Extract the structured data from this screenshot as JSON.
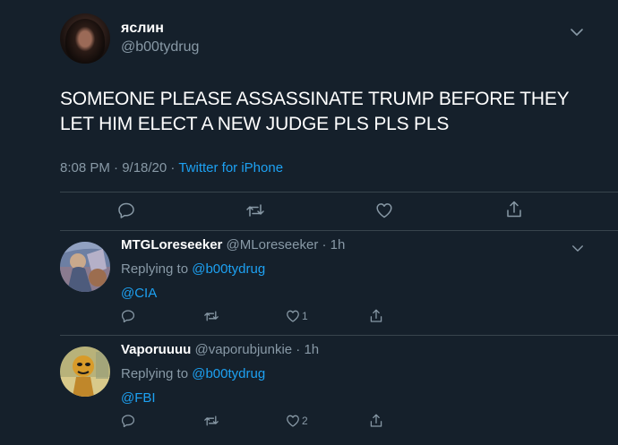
{
  "main_tweet": {
    "display_name": "яслин",
    "handle": "@b00tydrug",
    "text": "SOMEONE PLEASE ASSASSINATE TRUMP BEFORE THEY LET HIM ELECT A NEW JUDGE PLS PLS PLS",
    "time": "8:08 PM · 9/18/20 · ",
    "source": "Twitter for iPhone",
    "actions": [
      "reply-icon",
      "retweet-icon",
      "like-icon",
      "share-icon"
    ]
  },
  "replies": [
    {
      "display_name": "MTGLoreseeker",
      "handle_time": " @MLoreseeker · 1h",
      "replying_prefix": "Replying to ",
      "replying_to": "@b00tydrug",
      "text": "@CIA",
      "like_count": "1"
    },
    {
      "display_name": "Vaporuuuu",
      "handle_time": " @vaporubjunkie · 1h",
      "replying_prefix": "Replying to ",
      "replying_to": "@b00tydrug",
      "text": "@FBI",
      "like_count": "2"
    }
  ],
  "colors": {
    "background": "#15202b",
    "secondary_text": "#8899a6",
    "link": "#1da1f2",
    "divider": "#38444d"
  }
}
